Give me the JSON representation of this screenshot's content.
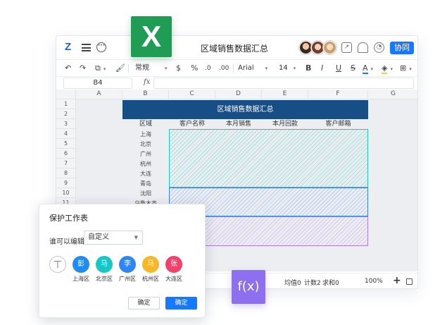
{
  "doc": {
    "title": "区域销售数据汇总",
    "collab_label": "协同"
  },
  "toolbar": {
    "number_format": "常规",
    "currency": "$",
    "percent": "%",
    "decimal_down": ".0",
    "decimal_up": ".00",
    "font_family": "Arial",
    "font_size": "14",
    "bold": "B",
    "italic": "I",
    "underline": "U",
    "strike": "S",
    "font_color": "A"
  },
  "formula_bar": {
    "cell_ref": "B4",
    "fx_label": "fx"
  },
  "columns": [
    "A",
    "B",
    "C",
    "D",
    "E",
    "F",
    "G"
  ],
  "rows": [
    "1",
    "2",
    "3",
    "4",
    "5",
    "6",
    "7",
    "8",
    "9",
    "10",
    "11"
  ],
  "sheet": {
    "banner": "区域销售数据汇总",
    "headers": [
      "区域",
      "客户名称",
      "本月销售",
      "本月回款",
      "客户邮箱"
    ],
    "regions": [
      "上海",
      "北京",
      "广州",
      "杭州",
      "大连",
      "青岛",
      "沈阳",
      "乌鲁木齐"
    ]
  },
  "status": {
    "avg": "均值0",
    "count": "计数2",
    "sum": "求和0",
    "zoom": "100%"
  },
  "logos": {
    "excel": "X",
    "fx": "f(x)"
  },
  "dialog": {
    "title": "保护工作表",
    "who_label": "谁可以编辑",
    "select_value": "自定义",
    "add_symbol": "丅",
    "editors": [
      {
        "initial": "彭",
        "label": "上海区",
        "color": "#1e8cf0"
      },
      {
        "initial": "马",
        "label": "北京区",
        "color": "#17c7c6"
      },
      {
        "initial": "李",
        "label": "广州区",
        "color": "#2f86f2"
      },
      {
        "initial": "马",
        "label": "杭州区",
        "color": "#f6b82b"
      },
      {
        "initial": "张",
        "label": "大连区",
        "color": "#f0426b"
      }
    ],
    "cancel_label": "确定",
    "ok_label": "确定"
  }
}
